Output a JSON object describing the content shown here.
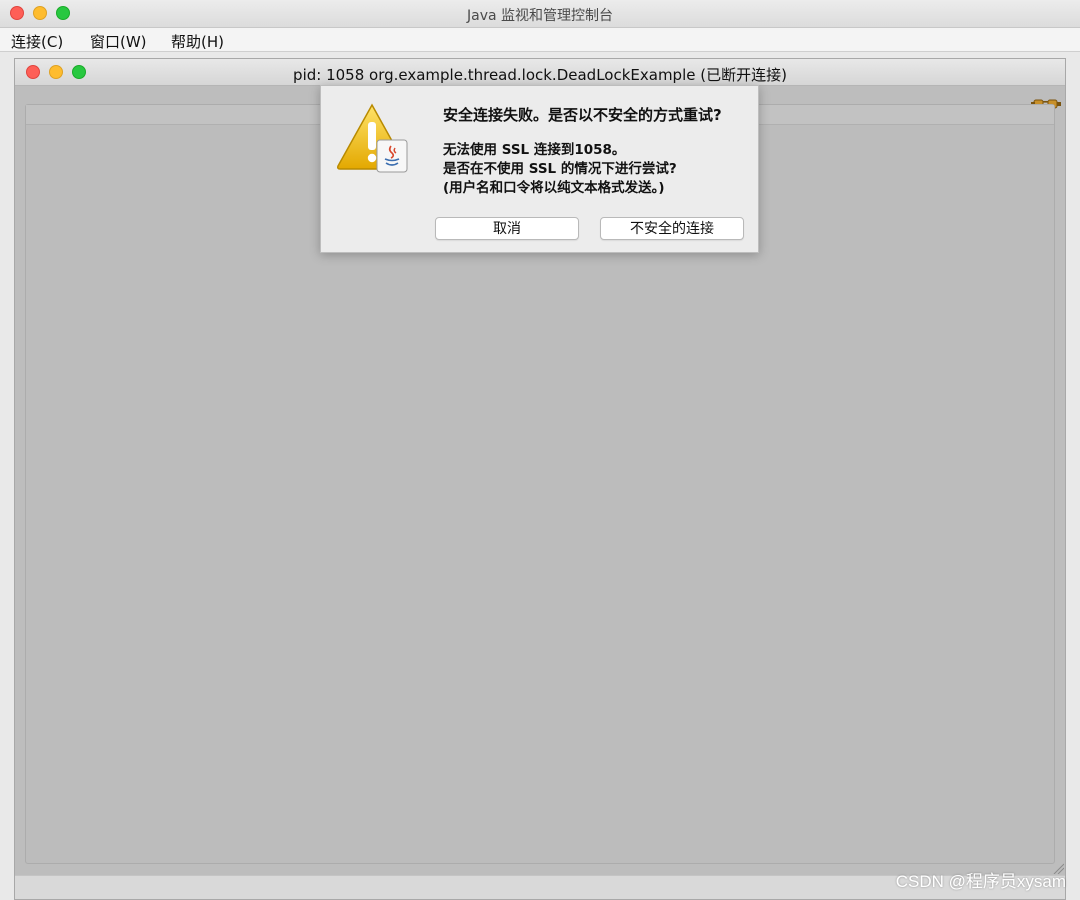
{
  "app": {
    "title": "Java 监视和管理控制台"
  },
  "menubar": {
    "items": [
      {
        "label": "连接(C)"
      },
      {
        "label": "窗口(W)"
      },
      {
        "label": "帮助(H)"
      }
    ]
  },
  "inner_window": {
    "title": "pid: 1058 org.example.thread.lock.DeadLockExample (已断开连接)",
    "status_icon": "disconnected-plug-icon"
  },
  "dialog": {
    "icon": "warning-java-icon",
    "title": "安全连接失败。是否以不安全的方式重试?",
    "lines": [
      "无法使用 SSL 连接到1058。",
      "是否在不使用 SSL 的情况下进行尝试?",
      "(用户名和口令将以纯文本格式发送。)"
    ],
    "cancel_label": "取消",
    "insecure_label": "不安全的连接"
  },
  "watermark": "CSDN @程序员xysam",
  "colors": {
    "close": "#fe5f57",
    "minimize": "#febc2e",
    "zoom": "#28c840",
    "warning": "#f2c200"
  }
}
